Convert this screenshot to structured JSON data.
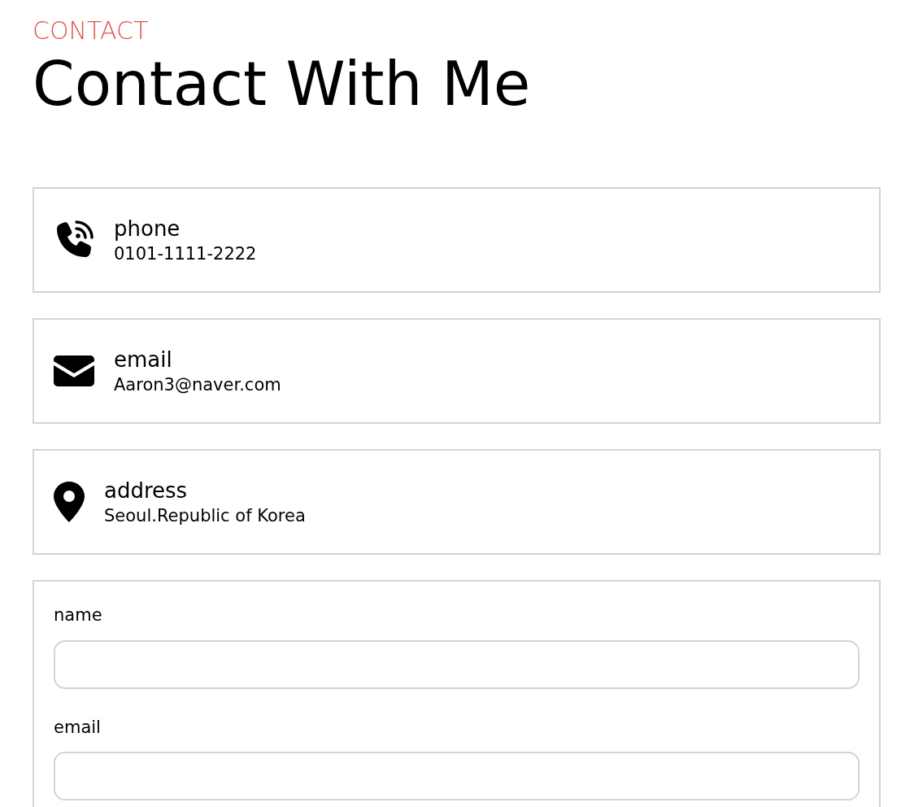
{
  "section_label": "CONTACT",
  "title": "Contact With Me",
  "contact_items": [
    {
      "kind": "phone",
      "label": "phone",
      "value": "0101-1111-2222"
    },
    {
      "kind": "email",
      "label": "email",
      "value": "Aaron3@naver.com"
    },
    {
      "kind": "address",
      "label": "address",
      "value": "Seoul.Republic of Korea"
    }
  ],
  "form": {
    "fields": [
      {
        "label": "name"
      },
      {
        "label": "email"
      }
    ]
  }
}
